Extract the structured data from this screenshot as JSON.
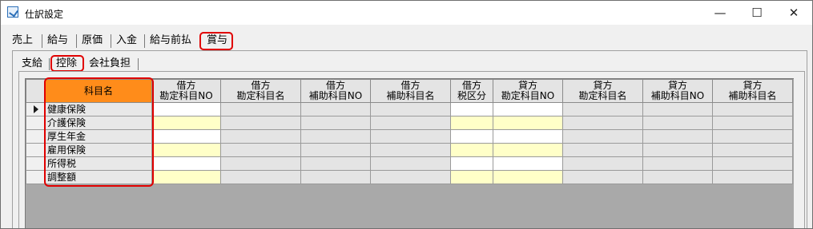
{
  "window": {
    "title": "仕訳設定",
    "icon": "journal-settings-icon",
    "min_glyph": "—",
    "max_glyph": "☐",
    "close_glyph": "✕"
  },
  "main_tabs": [
    {
      "label": "売上",
      "selected": false
    },
    {
      "label": "給与",
      "selected": false
    },
    {
      "label": "原価",
      "selected": false
    },
    {
      "label": "入金",
      "selected": false
    },
    {
      "label": "給与前払",
      "selected": false
    },
    {
      "label": "賞与",
      "selected": true
    }
  ],
  "sub_tabs": [
    {
      "label": "支給",
      "selected": false
    },
    {
      "label": "控除",
      "selected": true
    },
    {
      "label": "会社負担",
      "selected": false
    }
  ],
  "grid": {
    "headers": [
      {
        "line1": "科目名",
        "line2": ""
      },
      {
        "line1": "借方",
        "line2": "勘定科目NO"
      },
      {
        "line1": "借方",
        "line2": "勘定科目名"
      },
      {
        "line1": "借方",
        "line2": "補助科目NO"
      },
      {
        "line1": "借方",
        "line2": "補助科目名"
      },
      {
        "line1": "借方",
        "line2": "税区分"
      },
      {
        "line1": "貸方",
        "line2": "勘定科目NO"
      },
      {
        "line1": "貸方",
        "line2": "勘定科目名"
      },
      {
        "line1": "貸方",
        "line2": "補助科目NO"
      },
      {
        "line1": "貸方",
        "line2": "補助科目名"
      }
    ],
    "rows": [
      {
        "name": "健康保険",
        "current": true
      },
      {
        "name": "介護保険",
        "current": false
      },
      {
        "name": "厚生年金",
        "current": false
      },
      {
        "name": "雇用保険",
        "current": false
      },
      {
        "name": "所得税",
        "current": false
      },
      {
        "name": "調整額",
        "current": false
      }
    ],
    "current_row_icon": "row-pointer-icon"
  },
  "colors": {
    "highlight_header": "#ff8c1a",
    "annotation_red": "#e00000",
    "editable_yellow": "#ffffc8",
    "editable_white": "#ffffff"
  }
}
